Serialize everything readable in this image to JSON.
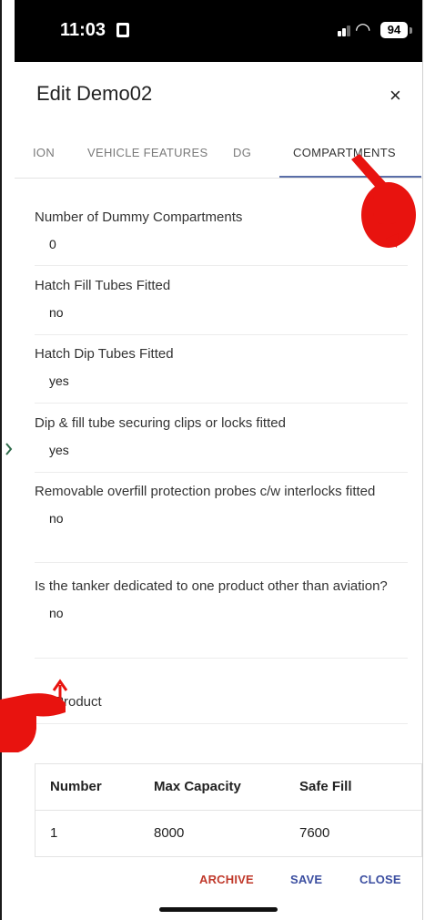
{
  "status_bar": {
    "time": "11:03",
    "battery": "94"
  },
  "dialog": {
    "title": "Edit Demo02",
    "close_icon": "×"
  },
  "tabs": [
    {
      "label": "ION"
    },
    {
      "label": "VEHICLE FEATURES"
    },
    {
      "label": "DG"
    },
    {
      "label": "COMPARTMENTS",
      "active": true
    }
  ],
  "fields": [
    {
      "label": "Number of Dummy Compartments",
      "value": "0"
    },
    {
      "label": "Hatch Fill Tubes Fitted",
      "value": "no"
    },
    {
      "label": "Hatch Dip Tubes Fitted",
      "value": "yes"
    },
    {
      "label": "Dip & fill tube securing clips or locks fitted",
      "value": "yes"
    },
    {
      "label": "Removable overfill protection probes c/w interlocks fitted",
      "value": "no"
    },
    {
      "label": "Is the tanker dedicated to one product other than aviation?",
      "value": "no"
    }
  ],
  "product": {
    "label": "Product"
  },
  "table": {
    "headers": [
      "Number",
      "Max Capacity",
      "Safe Fill"
    ],
    "rows": [
      [
        "1",
        "8000",
        "7600"
      ]
    ]
  },
  "footer": {
    "archive": "ARCHIVE",
    "save": "SAVE",
    "close": "CLOSE"
  },
  "colors": {
    "archive": "#c0392b",
    "save": "#3b4ea0",
    "close": "#3b4ea0",
    "pointer": "#e8130f",
    "tab_indicator": "#5a6ea8"
  },
  "icons": {
    "pointer_right": "pointing-hand-icon",
    "pointer_left": "pointing-hand-icon",
    "arrow": "arrow-up-icon"
  }
}
